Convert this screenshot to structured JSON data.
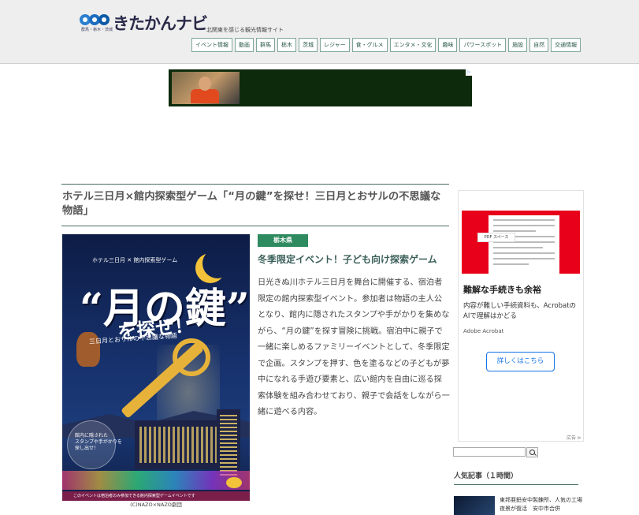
{
  "header": {
    "logo_text": "きたかんナビ",
    "logo_sub": "群馬・栃木・茨城",
    "tagline": "北関東を感じる観光情報サイト",
    "nav": [
      "イベント情報",
      "動画",
      "群馬",
      "栃木",
      "茨城",
      "レジャー",
      "食・グルメ",
      "エンタメ・文化",
      "趣味",
      "パワースポット",
      "施設",
      "自然",
      "交通情報"
    ]
  },
  "article": {
    "title": "ホテル三日月×館内探索型ゲーム「“月の鍵”を探せ！三日月とおサルの不思議な物語」",
    "prefecture_tag": "栃木県",
    "subheading": "冬季限定イベント！子ども向け探索ゲーム",
    "body": "日光きぬ川ホテル三日月を舞台に開催する、宿泊者限定の館内探索型イベント。参加者は物語の主人公となり、館内に隠されたスタンプや手がかりを集めながら、“月の鍵”を探す冒険に挑戦。宿泊中に親子で一緒に楽しめるファミリーイベントとして、冬季限定で企画。スタンプを押す、色を塗るなどの子どもが夢中になれる手遊び要素と、広い館内を自由に巡る探索体験を組み合わせており、親子で会話をしながら一緒に遊べる内容。",
    "image_caption": "(C)NAZO×NAZO劇団",
    "poster": {
      "subtitle": "ホテル三日月 ✕ 館内探索型ゲーム",
      "title_line1": "“月の鍵”",
      "title_line2": "を探せ！",
      "tagline": "三日月とおサルの不思議な物語",
      "bubble": "館内に隠された\nスタンプや手がかりを\n探し出せ！",
      "footer": "このイベントは宿泊者のみ参加できる館内探索型ゲームイベントです"
    }
  },
  "sidebar": {
    "ad": {
      "pdf_label": "PDF スペース",
      "title": "難解な手続きも余裕",
      "text": "内容が難しい手続資料も、AcrobatのAIで理解はかどる",
      "brand": "Adobe Acrobat",
      "button": "詳しくはこちら",
      "ad_label": "広告"
    },
    "search": {
      "placeholder": ""
    },
    "popular": {
      "heading": "人気記事（１時間）",
      "items": [
        {
          "text": "東邦亜鉛安中製錬所、人気の工場夜景が復活　安中市合併"
        }
      ]
    }
  },
  "colors": {
    "accent_green": "#2e8a5f",
    "rule": "#4a6e63",
    "adobe_red": "#e8001a"
  }
}
